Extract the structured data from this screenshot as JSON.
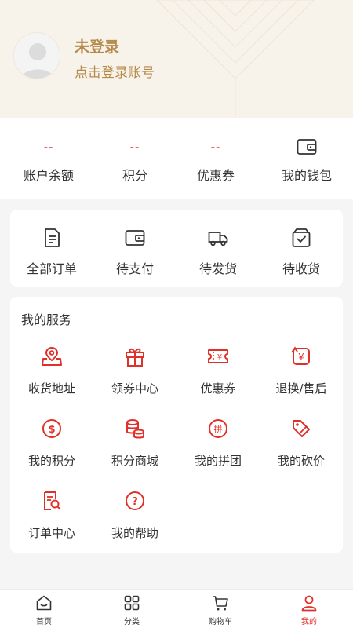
{
  "header": {
    "title": "未登录",
    "subtitle": "点击登录账号"
  },
  "assets": {
    "items": [
      {
        "value": "--",
        "label": "账户余额"
      },
      {
        "value": "--",
        "label": "积分"
      },
      {
        "value": "--",
        "label": "优惠券"
      }
    ],
    "wallet_label": "我的钱包"
  },
  "orders": {
    "items": [
      {
        "label": "全部订单",
        "icon": "order-list-icon"
      },
      {
        "label": "待支付",
        "icon": "wallet-icon"
      },
      {
        "label": "待发货",
        "icon": "truck-icon"
      },
      {
        "label": "待收货",
        "icon": "box-check-icon"
      }
    ]
  },
  "services": {
    "title": "我的服务",
    "items": [
      {
        "label": "收货地址",
        "icon": "location-map-icon"
      },
      {
        "label": "领券中心",
        "icon": "gift-icon"
      },
      {
        "label": "优惠券",
        "icon": "ticket-icon"
      },
      {
        "label": "退换/售后",
        "icon": "refund-icon"
      },
      {
        "label": "我的积分",
        "icon": "coin-icon"
      },
      {
        "label": "积分商城",
        "icon": "coins-stack-icon"
      },
      {
        "label": "我的拼团",
        "icon": "group-buy-icon"
      },
      {
        "label": "我的砍价",
        "icon": "price-tag-icon"
      },
      {
        "label": "订单中心",
        "icon": "order-search-icon"
      },
      {
        "label": "我的帮助",
        "icon": "help-icon"
      }
    ]
  },
  "tabbar": {
    "items": [
      {
        "label": "首页",
        "icon": "home-icon",
        "active": false
      },
      {
        "label": "分类",
        "icon": "grid-icon",
        "active": false
      },
      {
        "label": "购物车",
        "icon": "cart-icon",
        "active": false
      },
      {
        "label": "我的",
        "icon": "user-icon",
        "active": true
      }
    ]
  },
  "colors": {
    "accent": "#e0302a",
    "gold": "#b58a4a",
    "header_bg": "#f8f3ea",
    "page_bg": "#f5f5f5"
  }
}
